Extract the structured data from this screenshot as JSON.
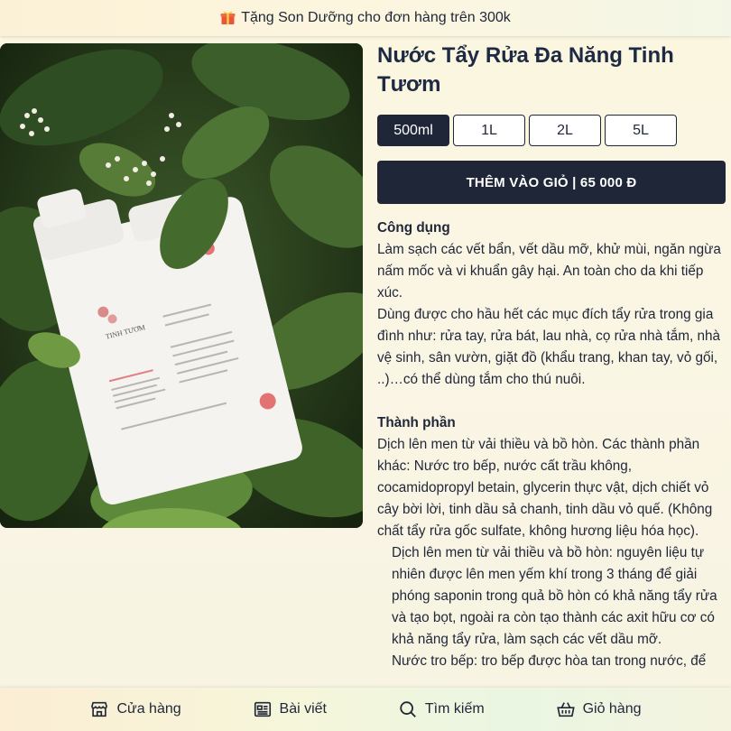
{
  "promo": {
    "text": "Tặng Son Dưỡng cho đơn hàng trên 300k",
    "icon": "gift-icon"
  },
  "product": {
    "title": "Nước Tẩy Rửa Đa Năng Tinh Tươm",
    "image_brand_text": "TINH TƯƠM",
    "variants": [
      {
        "label": "500ml",
        "selected": true
      },
      {
        "label": "1L",
        "selected": false
      },
      {
        "label": "2L",
        "selected": false
      },
      {
        "label": "5L",
        "selected": false
      }
    ],
    "add_to_cart_label": "THÊM VÀO GIỎ | 65 000 Đ"
  },
  "description": {
    "uses_heading": "Công dụng",
    "uses_p1": "Làm sạch các vết bẩn, vết dầu mỡ, khử mùi, ngăn ngừa nấm mốc và vi khuẩn gây hại. An toàn cho da khi tiếp xúc.",
    "uses_p2": "Dùng được cho hầu hết các mục đích tẩy rửa trong gia đình như: rửa tay, rửa bát, lau nhà, cọ rửa nhà tắm, nhà vệ sinh, sân vườn, giặt đồ (khẩu trang, khan tay, vỏ gối, ..)…có thể dùng tắm cho thú nuôi.",
    "ingredients_heading": "Thành phần",
    "ingredients_p1": "Dịch lên men từ vải thiều và bồ hòn. Các thành phần khác: Nước tro bếp, nước cất trầu không, cocamidopropyl betain, glycerin thực vật, dịch chiết vỏ cây bời lời, tinh dầu sả chanh, tinh dầu vỏ quế. (Không chất tẩy rửa gốc sulfate, không hương liệu hóa học).",
    "ingredients_p2": "Dịch lên men từ vải thiều và bồ hòn: nguyên liệu tự nhiên được lên men yếm khí trong 3 tháng để giải phóng saponin trong quả bồ hòn có khả năng tẩy rửa và tạo bọt, ngoài ra còn tạo thành các axit hữu cơ có khả năng tẩy rửa, làm sạch các vết dầu mỡ.",
    "ingredients_p3": "Nước tro bếp: tro bếp được hòa tan trong nước, để"
  },
  "bottom_nav": {
    "items": [
      {
        "label": "Cửa hàng",
        "icon": "store-icon"
      },
      {
        "label": "Bài viết",
        "icon": "article-icon"
      },
      {
        "label": "Tìm kiếm",
        "icon": "search-icon"
      },
      {
        "label": "Giỏ hàng",
        "icon": "basket-icon"
      }
    ]
  },
  "colors": {
    "primary": "#1e2638",
    "text": "#1e2638",
    "button_text": "#ffffff"
  }
}
